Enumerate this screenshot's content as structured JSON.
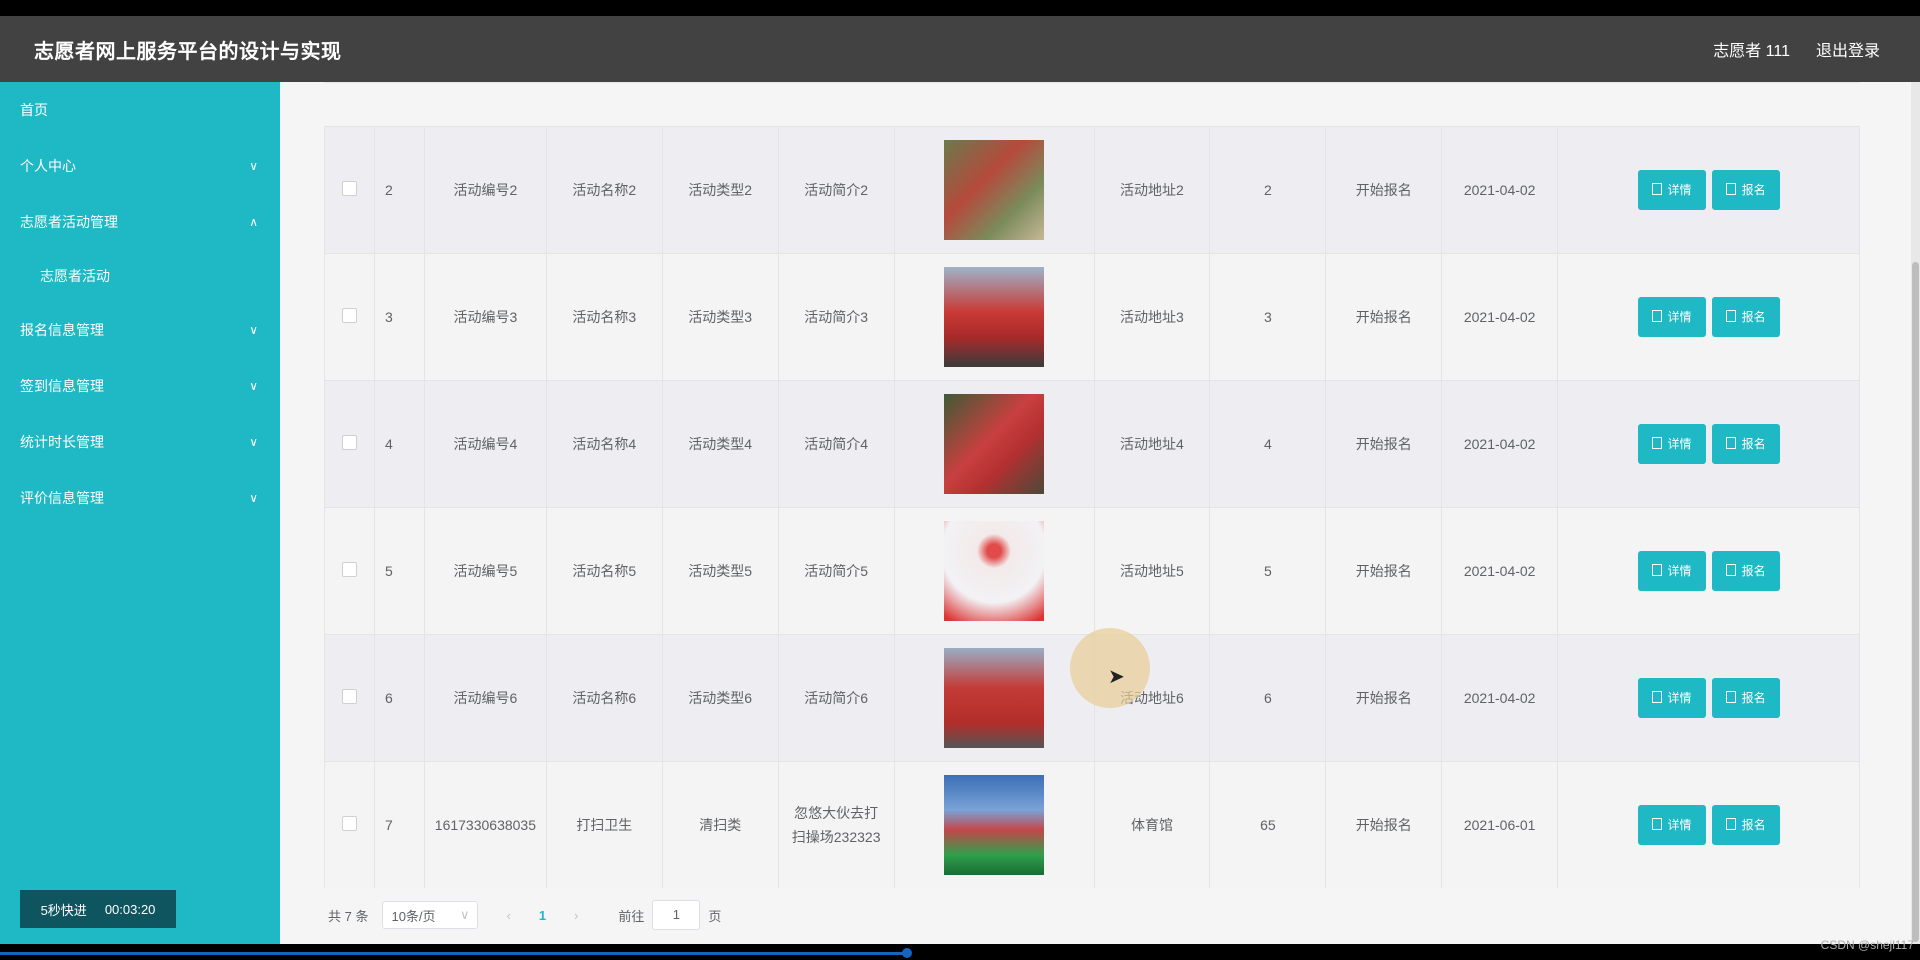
{
  "header": {
    "title": "志愿者网上服务平台的设计与实现",
    "user": "志愿者 111",
    "logout": "退出登录"
  },
  "sidebar": {
    "items": [
      {
        "label": "首页"
      },
      {
        "label": "个人中心"
      },
      {
        "label": "志愿者活动管理"
      },
      {
        "label": "志愿者活动"
      },
      {
        "label": "报名信息管理"
      },
      {
        "label": "签到信息管理"
      },
      {
        "label": "统计时长管理"
      },
      {
        "label": "评价信息管理"
      }
    ],
    "speed_label": "5秒快进",
    "timer": "00:03:20"
  },
  "table": {
    "rows": [
      {
        "no": "2",
        "code": "活动编号2",
        "name": "活动名称2",
        "type": "活动类型2",
        "intro": "活动简介2",
        "addr": "活动地址2",
        "count": "2",
        "status": "开始报名",
        "date": "2021-04-02"
      },
      {
        "no": "3",
        "code": "活动编号3",
        "name": "活动名称3",
        "type": "活动类型3",
        "intro": "活动简介3",
        "addr": "活动地址3",
        "count": "3",
        "status": "开始报名",
        "date": "2021-04-02"
      },
      {
        "no": "4",
        "code": "活动编号4",
        "name": "活动名称4",
        "type": "活动类型4",
        "intro": "活动简介4",
        "addr": "活动地址4",
        "count": "4",
        "status": "开始报名",
        "date": "2021-04-02"
      },
      {
        "no": "5",
        "code": "活动编号5",
        "name": "活动名称5",
        "type": "活动类型5",
        "intro": "活动简介5",
        "addr": "活动地址5",
        "count": "5",
        "status": "开始报名",
        "date": "2021-04-02"
      },
      {
        "no": "6",
        "code": "活动编号6",
        "name": "活动名称6",
        "type": "活动类型6",
        "intro": "活动简介6",
        "addr": "活动地址6",
        "count": "6",
        "status": "开始报名",
        "date": "2021-04-02"
      },
      {
        "no": "7",
        "code": "1617330638035",
        "name": "打扫卫生",
        "type": "清扫类",
        "intro": "忽悠大伙去打扫操场232323",
        "addr": "体育馆",
        "count": "65",
        "status": "开始报名",
        "date": "2021-06-01"
      }
    ],
    "detail_label": "详情",
    "signup_label": "报名"
  },
  "pager": {
    "total": "共 7 条",
    "page_size": "10条/页",
    "current": "1",
    "goto_label": "前往",
    "goto_value": "1",
    "page_unit": "页"
  },
  "watermark": "CSDN @shejl117"
}
